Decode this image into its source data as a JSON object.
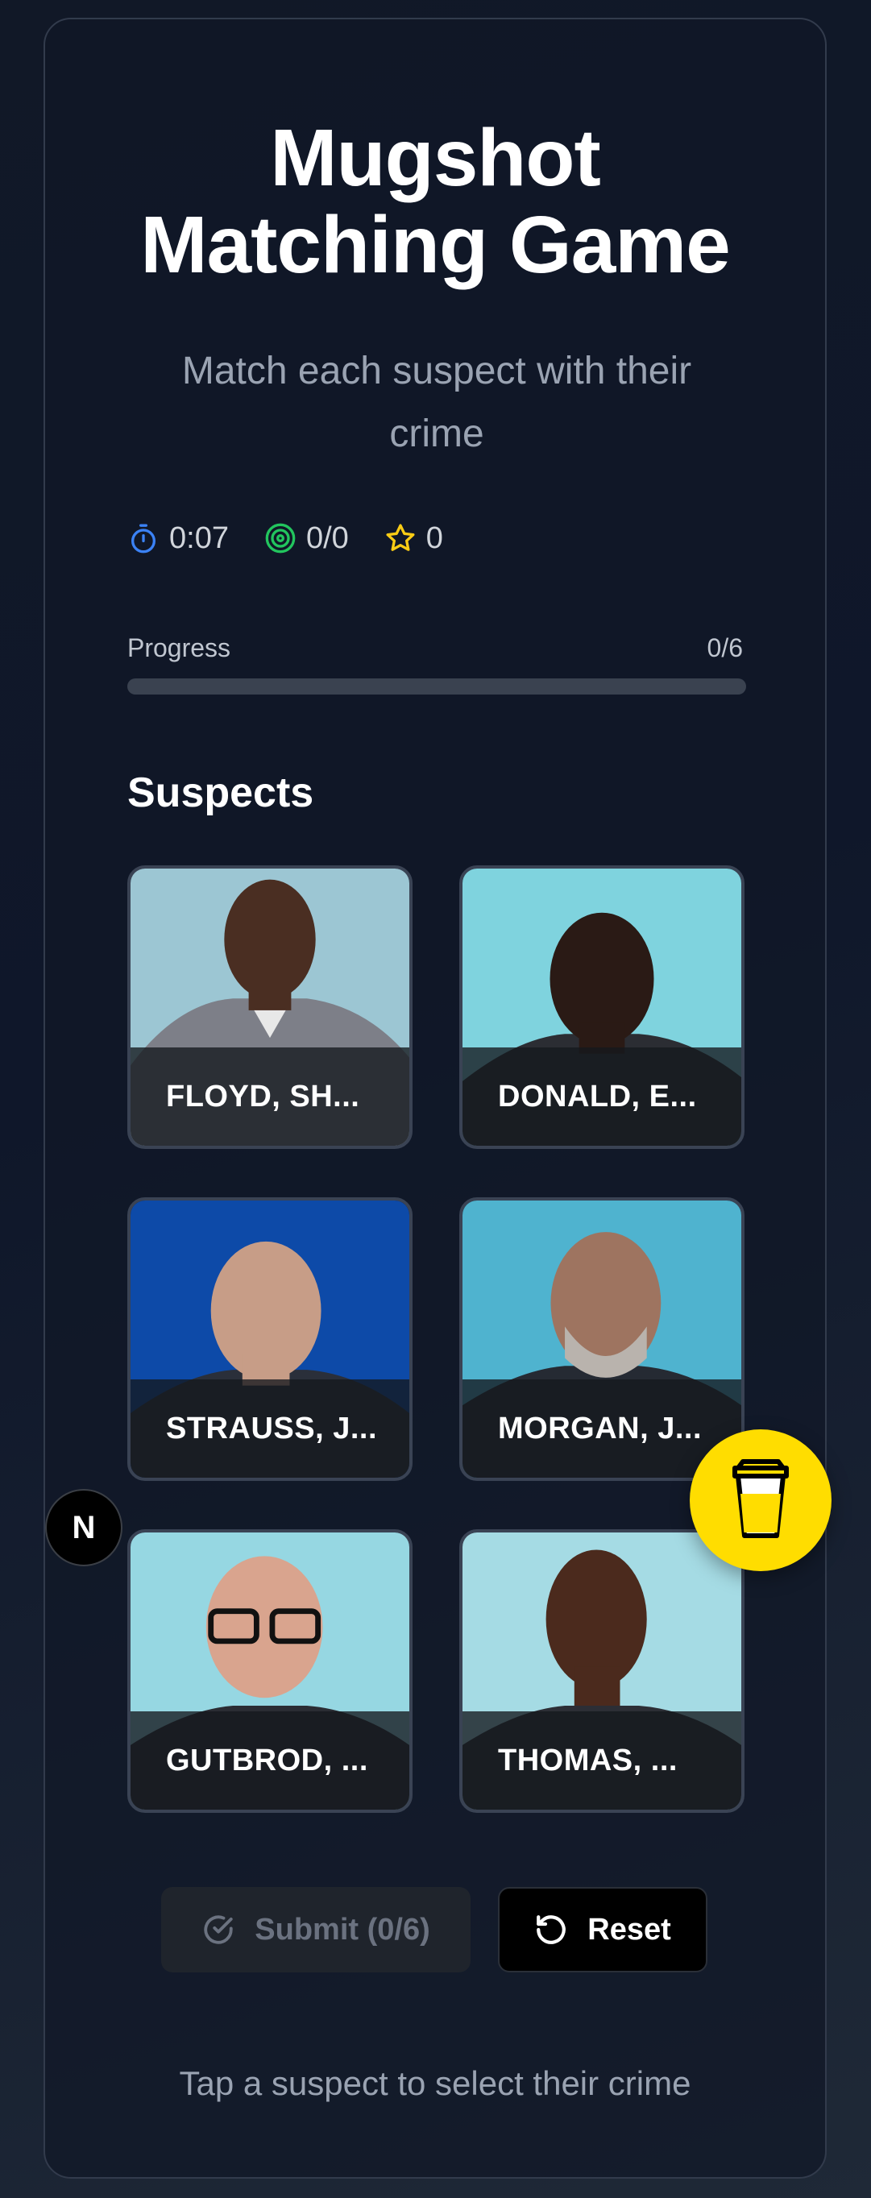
{
  "header": {
    "title_line1": "Mugshot",
    "title_line2": "Matching Game",
    "subtitle": "Match each suspect with their crime"
  },
  "stats": {
    "time": "0:07",
    "matches": "0/0",
    "score": "0",
    "timer_icon": "stopwatch-icon",
    "target_icon": "target-icon",
    "star_icon": "star-icon"
  },
  "progress": {
    "label": "Progress",
    "count": "0/6",
    "fraction": 0
  },
  "suspects": {
    "heading": "Suspects",
    "items": [
      {
        "name": "FLOYD, SH..."
      },
      {
        "name": "DONALD, E..."
      },
      {
        "name": "STRAUSS, J..."
      },
      {
        "name": "MORGAN, J..."
      },
      {
        "name": "GUTBROD, ..."
      },
      {
        "name": "THOMAS, ..."
      }
    ]
  },
  "actions": {
    "submit_label": "Submit (0/6)",
    "reset_label": "Reset"
  },
  "hint": "Tap a suspect to select their crime",
  "overlay": {
    "next_badge": "N",
    "coffee_icon": "coffee-cup-icon"
  },
  "colors": {
    "accent_blue": "#3b82f6",
    "target_green": "#22c55e",
    "star_yellow": "#facc15",
    "coffee_yellow": "#ffdd00"
  }
}
